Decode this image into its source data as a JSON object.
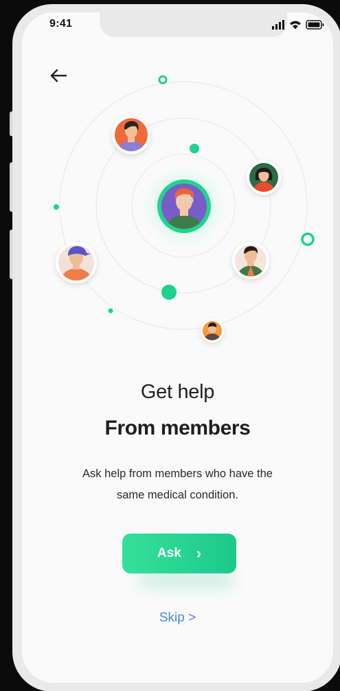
{
  "status_bar": {
    "time": "9:41",
    "icons": [
      "signal-icon",
      "wifi-icon",
      "battery-icon"
    ]
  },
  "nav": {
    "back_icon": "back-arrow-icon"
  },
  "illustration": {
    "avatars": [
      "avatar-member-1",
      "avatar-member-2",
      "avatar-member-3",
      "avatar-member-4",
      "avatar-member-5",
      "avatar-center-user"
    ],
    "accent_color": "#1ed18f"
  },
  "content": {
    "title_line1": "Get help",
    "title_line2": "From members",
    "description_line1": "Ask help from members who have the",
    "description_line2": "same medical condition."
  },
  "actions": {
    "ask_label": "Ask",
    "ask_chevron": "›",
    "skip_label": "Skip >"
  },
  "colors": {
    "primary": "#22cf8d",
    "link": "#3f8de0",
    "text": "#1e1e1e",
    "background": "#fafafa"
  }
}
